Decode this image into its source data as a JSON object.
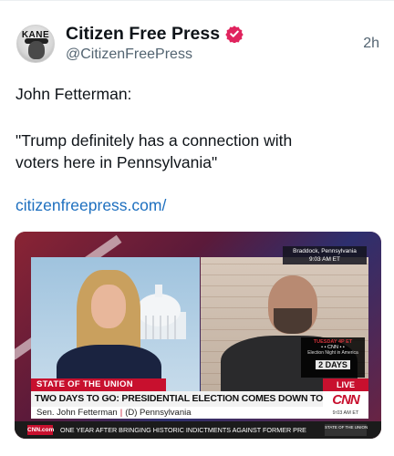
{
  "post": {
    "author_name": "Citizen Free Press",
    "handle": "@CitizenFreePress",
    "timestamp": "2h",
    "avatar_text": "KANE",
    "lines": [
      "John Fetterman:",
      "\"Trump definitely has a connection with",
      "voters here in Pennsylvania\""
    ],
    "link": "citizenfreepress.com/"
  },
  "media": {
    "location": "Braddock, Pennsylvania",
    "location_time": "9:03 AM ET",
    "election_day": "TUESDAY 4P ET",
    "election_network": "• • CNN • •",
    "election_title": "Election Night in America",
    "election_countdown": "2 DAYS",
    "show": "STATE OF THE UNION",
    "live": "LIVE",
    "headline": "TWO DAYS TO GO: PRESIDENTIAL ELECTION COMES DOWN TO THE WIRE",
    "guest_name": "Sen. John Fetterman",
    "guest_sep": "|",
    "guest_party": "(D) Pennsylvania",
    "logo": "CNN",
    "logo_time": "9:03 AM ET",
    "ticker_logo": "CNN.com",
    "ticker_text": "ONE YEAR AFTER BRINGING HISTORIC INDICTMENTS AGAINST FORMER PRE",
    "ticker_badge": "STATE OF THE UNION"
  },
  "colors": {
    "link": "#1d6fbf",
    "verified": "#e0245e",
    "cnn_red": "#c8102e"
  }
}
